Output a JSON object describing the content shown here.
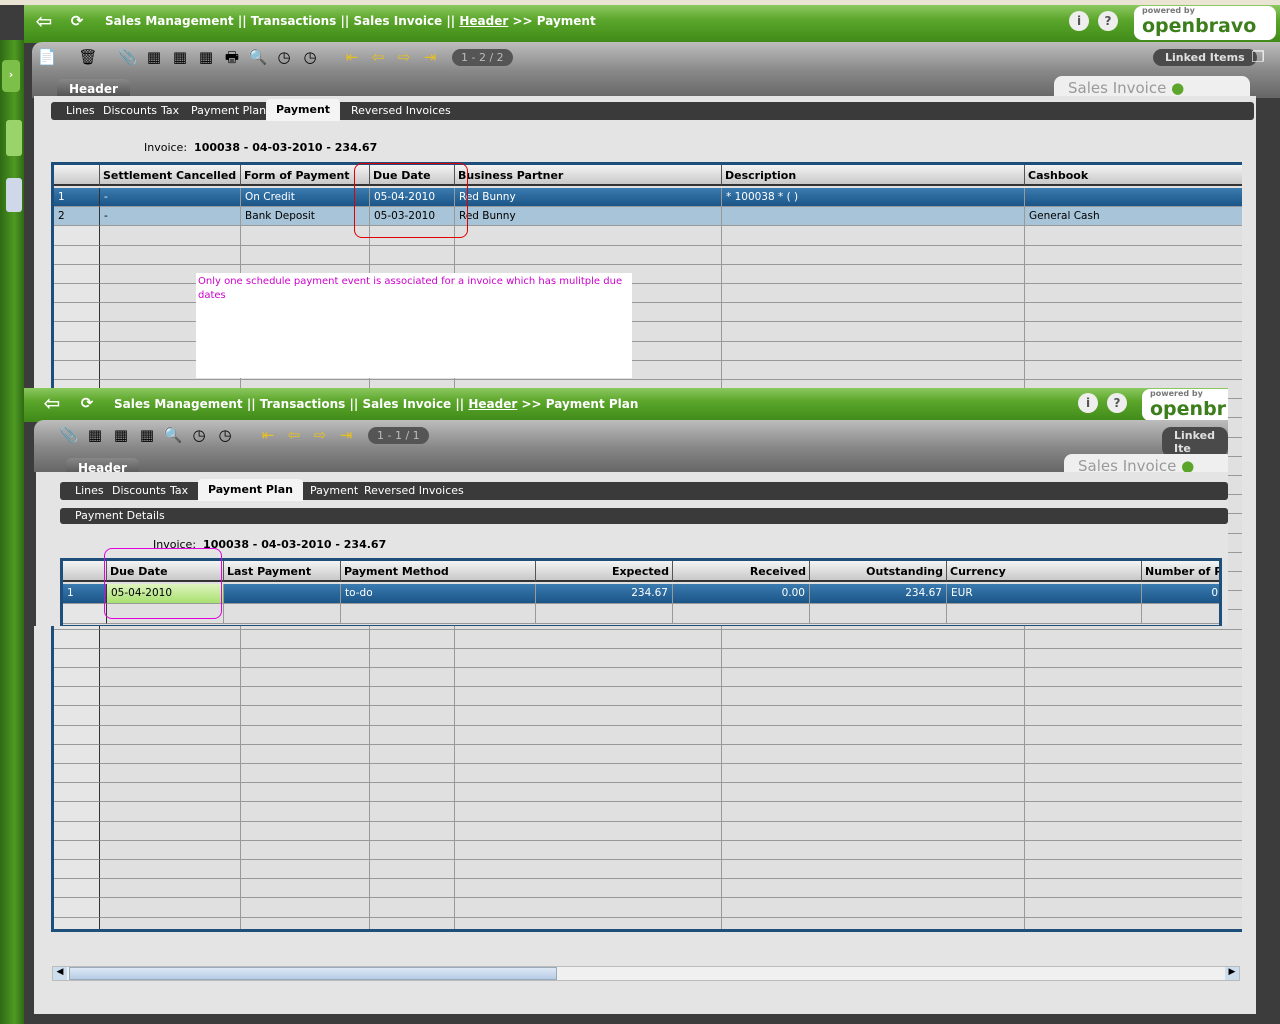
{
  "window1": {
    "breadcrumb": {
      "part1": "Sales Management || Transactions || Sales Invoice ||",
      "header_link": "Header",
      "sep": ">>",
      "current": "Payment"
    },
    "pager": "1 - 2 / 2",
    "linked_items": "Linked Items",
    "sales_invoice_tab": "Sales Invoice",
    "logo": {
      "powered_by": "powered by",
      "name": "openbravo"
    },
    "header_tab": "Header",
    "tabs": [
      "Lines",
      "Discounts",
      "Tax",
      "Payment Plan",
      "Payment",
      "Reversed Invoices"
    ],
    "selected_tab": "Payment",
    "invoice_label": "Invoice:",
    "invoice_value": "100038 - 04-03-2010 - 234.67",
    "grid": {
      "columns": [
        "Settlement Cancelled",
        "Form of Payment",
        "Due Date",
        "Business Partner",
        "Description",
        "Cashbook"
      ],
      "rows": [
        {
          "n": "1",
          "cells": [
            "-",
            "On Credit",
            "05-04-2010",
            "Red Bunny",
            "* 100038 * ( )",
            ""
          ]
        },
        {
          "n": "2",
          "cells": [
            "-",
            "Bank Deposit",
            "05-03-2010",
            "Red Bunny",
            "",
            "General Cash"
          ]
        }
      ]
    }
  },
  "annotation": "Only one schedule payment event is associated for a invoice which has mulitple due dates",
  "window2": {
    "breadcrumb": {
      "part1": "Sales Management || Transactions || Sales Invoice ||",
      "header_link": "Header",
      "sep": ">>",
      "current": "Payment Plan"
    },
    "pager": "1 - 1 / 1",
    "linked_items": "Linked Ite",
    "sales_invoice_tab": "Sales Invoice",
    "logo": {
      "powered_by": "powered by",
      "name": "openbr"
    },
    "header_tab": "Header",
    "tabs": [
      "Lines",
      "Discounts",
      "Tax",
      "Payment Plan",
      "Payment",
      "Reversed Invoices"
    ],
    "selected_tab": "Payment Plan",
    "subtab": "Payment Details",
    "invoice_label": "Invoice:",
    "invoice_value": "100038 - 04-03-2010 - 234.67",
    "grid": {
      "columns": [
        "Due Date",
        "Last Payment",
        "Payment Method",
        "Expected",
        "Received",
        "Outstanding",
        "Currency",
        "Number of Pa"
      ],
      "rows": [
        {
          "n": "1",
          "cells": [
            "05-04-2010",
            "",
            "to-do",
            "234.67",
            "0.00",
            "234.67",
            "EUR",
            "0"
          ]
        }
      ]
    }
  },
  "colors": {
    "green": "#4e9a22",
    "selection": "#1b5587",
    "annotation": "#cc00cc",
    "highlight": "#e00000"
  }
}
